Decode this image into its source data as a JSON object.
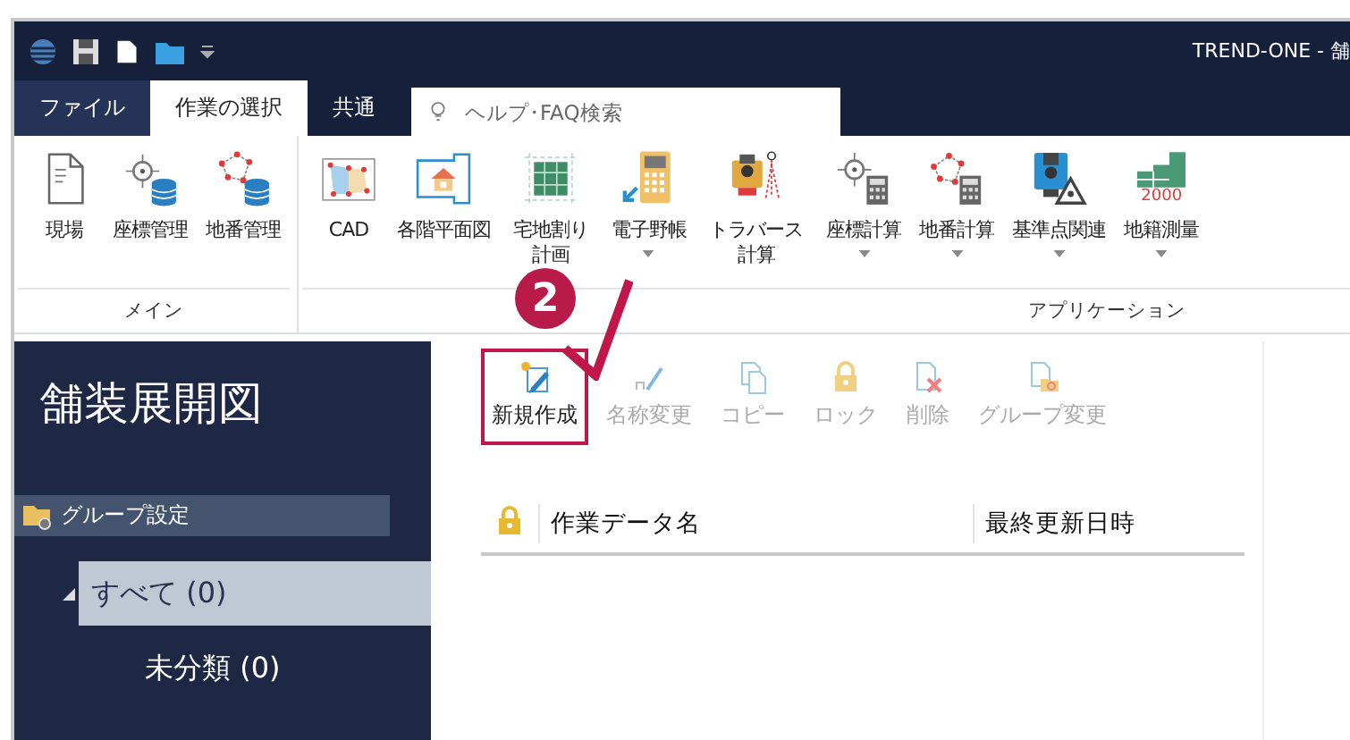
{
  "window": {
    "title": "TREND-ONE - 舗"
  },
  "tabs": [
    {
      "label": "ファイル",
      "selected": false,
      "kind": "file"
    },
    {
      "label": "作業の選択",
      "selected": true,
      "kind": "tab"
    },
    {
      "label": "共通",
      "selected": false,
      "kind": "tab"
    }
  ],
  "search": {
    "placeholder": "ヘルプ･FAQ検索"
  },
  "ribbon_groups": [
    {
      "label": "メイン",
      "buttons": [
        {
          "label": "現場",
          "dropdown": false
        },
        {
          "label": "座標管理",
          "dropdown": false
        },
        {
          "label": "地番管理",
          "dropdown": false
        }
      ]
    },
    {
      "label": "アプリケーション",
      "buttons": [
        {
          "label": "CAD",
          "dropdown": false
        },
        {
          "label": "各階平面図",
          "dropdown": false
        },
        {
          "label": "宅地割り計画",
          "dropdown": false
        },
        {
          "label": "電子野帳",
          "dropdown": true
        },
        {
          "label": "トラバース計算",
          "dropdown": false
        },
        {
          "label": "座標計算",
          "dropdown": true
        },
        {
          "label": "地番計算",
          "dropdown": true
        },
        {
          "label": "基準点関連",
          "dropdown": true
        },
        {
          "label": "地籍測量",
          "icon_caption": "2000",
          "dropdown": true
        }
      ]
    }
  ],
  "sidebar": {
    "title": "舗装展開図",
    "group_header": "グループ設定",
    "tree": [
      {
        "label": "すべて (0)",
        "selected": true,
        "expanded": true,
        "children": [
          {
            "label": "未分類 (0)",
            "selected": false
          }
        ]
      }
    ]
  },
  "toolbar": [
    {
      "label": "新規作成",
      "disabled": false,
      "highlighted": true
    },
    {
      "label": "名称変更",
      "disabled": true,
      "highlighted": false
    },
    {
      "label": "コピー",
      "disabled": true,
      "highlighted": false
    },
    {
      "label": "ロック",
      "disabled": true,
      "highlighted": false
    },
    {
      "label": "削除",
      "disabled": true,
      "highlighted": false
    },
    {
      "label": "グループ変更",
      "disabled": true,
      "highlighted": false
    }
  ],
  "table": {
    "columns": [
      {
        "kind": "lock"
      },
      {
        "kind": "text",
        "label": "作業データ名"
      },
      {
        "kind": "text",
        "label": "最終更新日時"
      }
    ]
  },
  "callout": {
    "number": "2"
  }
}
